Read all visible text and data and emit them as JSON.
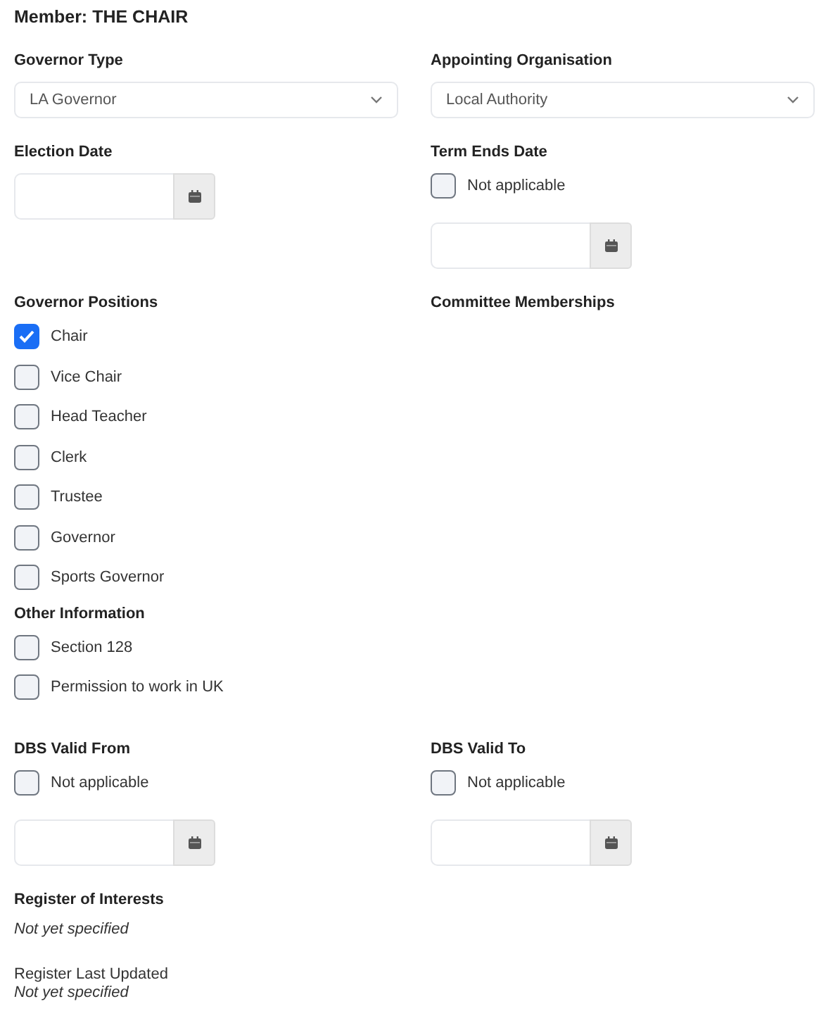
{
  "title": "Member: THE CHAIR",
  "governor_type": {
    "label": "Governor Type",
    "value": "LA Governor"
  },
  "appointing_organisation": {
    "label": "Appointing Organisation",
    "value": "Local Authority"
  },
  "election_date": {
    "label": "Election Date"
  },
  "term_ends_date": {
    "label": "Term Ends Date",
    "not_applicable": {
      "label": "Not applicable",
      "checked": false
    }
  },
  "governor_positions": {
    "label": "Governor Positions",
    "items": [
      {
        "label": "Chair",
        "checked": true
      },
      {
        "label": "Vice Chair",
        "checked": false
      },
      {
        "label": "Head Teacher",
        "checked": false
      },
      {
        "label": "Clerk",
        "checked": false
      },
      {
        "label": "Trustee",
        "checked": false
      },
      {
        "label": "Governor",
        "checked": false
      },
      {
        "label": "Sports Governor",
        "checked": false
      }
    ]
  },
  "committee_memberships": {
    "label": "Committee Memberships"
  },
  "other_information": {
    "label": "Other Information",
    "items": [
      {
        "label": "Section 128",
        "checked": false
      },
      {
        "label": "Permission to work in UK",
        "checked": false
      }
    ]
  },
  "dbs_valid_from": {
    "label": "DBS Valid From",
    "not_applicable": {
      "label": "Not applicable",
      "checked": false
    }
  },
  "dbs_valid_to": {
    "label": "DBS Valid To",
    "not_applicable": {
      "label": "Not applicable",
      "checked": false
    }
  },
  "register_of_interests": {
    "label": "Register of Interests",
    "value": "Not yet specified"
  },
  "register_last_updated": {
    "label": "Register Last Updated",
    "value": "Not yet specified"
  }
}
